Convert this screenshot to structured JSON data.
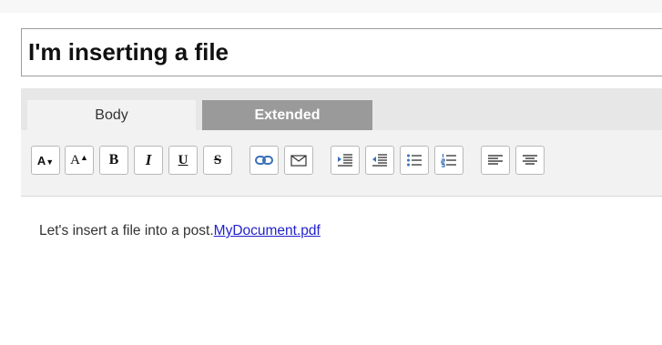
{
  "title_field": {
    "value": "I'm inserting a file"
  },
  "tabs": [
    {
      "label": "Body",
      "active": true
    },
    {
      "label": "Extended",
      "active": false
    }
  ],
  "toolbar": {
    "buttons": [
      {
        "name": "decrease-font-size",
        "glyph": "A▾"
      },
      {
        "name": "increase-font-size",
        "glyph": "A▴"
      },
      {
        "name": "bold",
        "glyph": "B"
      },
      {
        "name": "italic",
        "glyph": "I"
      },
      {
        "name": "underline",
        "glyph": "U"
      },
      {
        "name": "strikethrough",
        "glyph": "S"
      },
      {
        "name": "insert-link",
        "glyph": "link-icon"
      },
      {
        "name": "insert-email",
        "glyph": "envelope-icon"
      },
      {
        "name": "indent",
        "glyph": "indent-icon"
      },
      {
        "name": "outdent",
        "glyph": "outdent-icon"
      },
      {
        "name": "bulleted-list",
        "glyph": "bulleted-list-icon"
      },
      {
        "name": "numbered-list",
        "glyph": "numbered-list-icon"
      },
      {
        "name": "align-left",
        "glyph": "align-left-icon"
      },
      {
        "name": "align-center",
        "glyph": "align-center-icon"
      }
    ]
  },
  "content": {
    "text": "Let's insert a file into a post.",
    "link_text": "MyDocument.pdf"
  },
  "colors": {
    "tab_active_bg": "#f2f2f2",
    "tab_inactive_bg": "#9a9a9a",
    "link": "#2222cc",
    "text": "#333333"
  }
}
